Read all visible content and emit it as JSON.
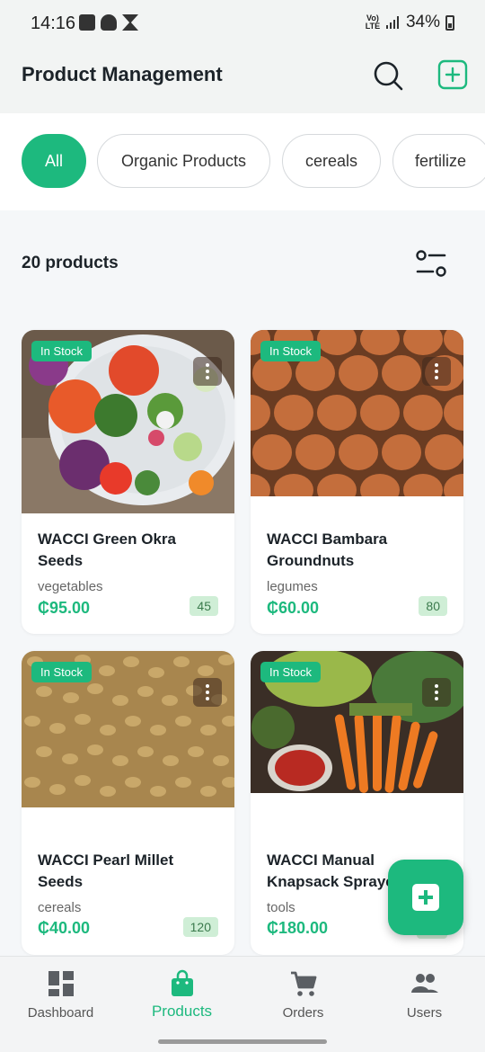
{
  "status_bar": {
    "time": "14:16",
    "network": "Vo) 4G LTE",
    "battery": "34%"
  },
  "header": {
    "title": "Product Management"
  },
  "filters": {
    "chips": [
      {
        "label": "All",
        "active": true
      },
      {
        "label": "Organic Products",
        "active": false
      },
      {
        "label": "cereals",
        "active": false
      },
      {
        "label": "fertilize",
        "active": false
      }
    ]
  },
  "summary": {
    "count_text": "20 products"
  },
  "products": [
    {
      "name": "WACCI Green Okra\nSeeds",
      "category": "vegetables",
      "price": "₵95.00",
      "qty": "45",
      "status": "In Stock"
    },
    {
      "name": "WACCI Bambara\nGroundnuts",
      "category": "legumes",
      "price": "₵60.00",
      "qty": "80",
      "status": "In Stock"
    },
    {
      "name": "WACCI Pearl Millet\nSeeds",
      "category": "cereals",
      "price": "₵40.00",
      "qty": "120",
      "status": "In Stock"
    },
    {
      "name": "WACCI Manual\nKnapsack Sprayer",
      "category": "tools",
      "price": "₵180.00",
      "qty": "",
      "status": "In Stock"
    }
  ],
  "bottom_nav": {
    "items": [
      {
        "label": "Dashboard",
        "icon": "dashboard-icon"
      },
      {
        "label": "Products",
        "icon": "shopping-bag-icon"
      },
      {
        "label": "Orders",
        "icon": "cart-icon"
      },
      {
        "label": "Users",
        "icon": "users-icon"
      }
    ]
  },
  "colors": {
    "accent": "#1db97e",
    "qty_badge": "#cfeed6",
    "background": "#f5f7f9"
  }
}
